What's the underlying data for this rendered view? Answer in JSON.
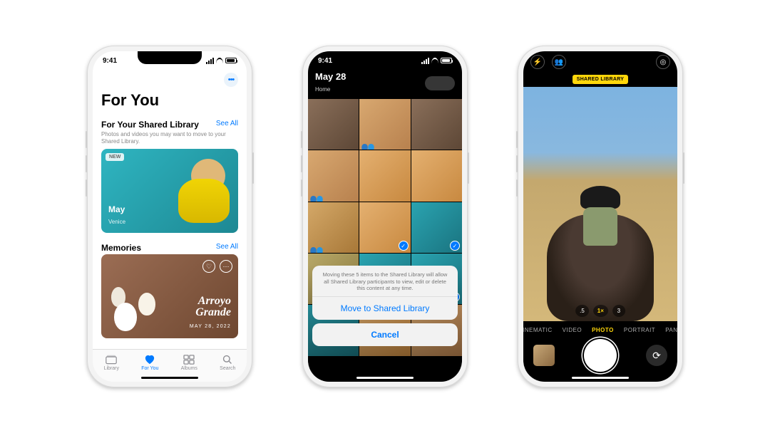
{
  "status_time": "9:41",
  "phone1": {
    "title": "For You",
    "shared": {
      "heading": "For Your Shared Library",
      "see_all": "See All",
      "subtitle": "Photos and videos you may want to move to your Shared Library.",
      "badge": "NEW",
      "card_title": "May",
      "card_sub": "Venice"
    },
    "memories": {
      "heading": "Memories",
      "see_all": "See All",
      "title_line1": "Arroyo",
      "title_line2": "Grande",
      "date": "MAY 28, 2022"
    },
    "tabs": {
      "library": "Library",
      "for_you": "For You",
      "albums": "Albums",
      "search": "Search"
    }
  },
  "phone2": {
    "title": "May 28",
    "subtitle": "Home",
    "sheet_message": "Moving these 5 items to the Shared Library will allow all Shared Library participants to view, edit or delete this content at any time.",
    "move_btn": "Move to Shared Library",
    "cancel_btn": "Cancel"
  },
  "phone3": {
    "badge": "SHARED LIBRARY",
    "zoom": {
      "a": ".5",
      "b": "1×",
      "c": "3"
    },
    "modes": {
      "cinematic": "CINEMATIC",
      "video": "VIDEO",
      "photo": "PHOTO",
      "portrait": "PORTRAIT",
      "pano": "PANO"
    }
  }
}
